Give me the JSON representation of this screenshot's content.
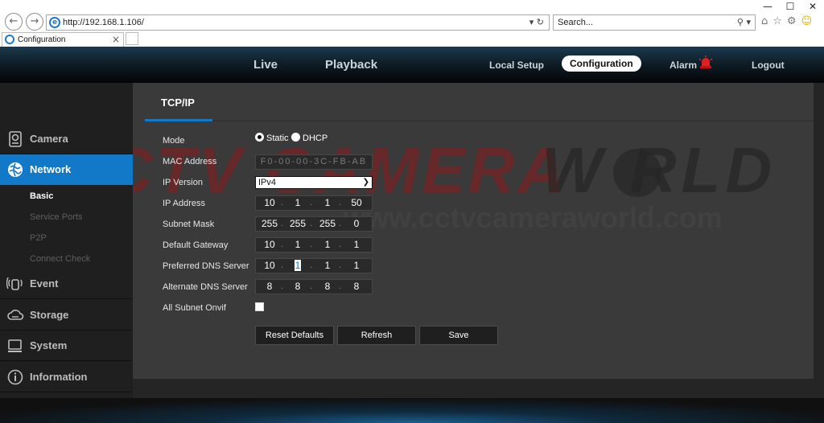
{
  "browser": {
    "url": "http://192.168.1.106/",
    "search_placeholder": "Search...",
    "tab_title": "Configuration",
    "window_controls": [
      "—",
      "☐",
      "✕"
    ]
  },
  "topnav": {
    "items": [
      "Live",
      "Playback",
      "Local Setup",
      "Configuration",
      "Alarm",
      "Logout"
    ],
    "active": "Configuration"
  },
  "sidebar": {
    "groups": [
      {
        "label": "Camera",
        "icon": "camera-icon"
      },
      {
        "label": "Network",
        "icon": "network-globe-icon"
      },
      {
        "label": "Event",
        "icon": "event-signal-icon"
      },
      {
        "label": "Storage",
        "icon": "storage-cloud-icon"
      },
      {
        "label": "System",
        "icon": "system-monitor-icon"
      },
      {
        "label": "Information",
        "icon": "info-icon"
      }
    ],
    "network_subitems": [
      "Basic",
      "Service Ports",
      "P2P",
      "Connect Check"
    ],
    "active_group": "Network",
    "active_subitem": "Basic"
  },
  "content": {
    "tab": "TCP/IP",
    "watermark": {
      "brand": "CCTV CAMERA",
      "brand_right": "W  RLD",
      "site": "www.cctvcameraworld.com"
    },
    "form": {
      "mode_label": "Mode",
      "mode_options": [
        "Static",
        "DHCP"
      ],
      "mode_selected": "Static",
      "mac_label": "MAC Address",
      "mac_value": "F0-00-00-3C-FB-AB",
      "ip_version_label": "IP Version",
      "ip_version_value": "IPv4",
      "ip_address_label": "IP Address",
      "ip_address": [
        "10",
        "1",
        "1",
        "50"
      ],
      "subnet_label": "Subnet Mask",
      "subnet": [
        "255",
        "255",
        "255",
        "0"
      ],
      "gateway_label": "Default Gateway",
      "gateway": [
        "10",
        "1",
        "1",
        "1"
      ],
      "pref_dns_label": "Preferred DNS Server",
      "pref_dns": [
        "10",
        "1",
        "1",
        "1"
      ],
      "alt_dns_label": "Alternate DNS Server",
      "alt_dns": [
        "8",
        "8",
        "8",
        "8"
      ],
      "onvif_label": "All Subnet Onvif",
      "onvif_checked": false
    },
    "buttons": {
      "reset": "Reset Defaults",
      "refresh": "Refresh",
      "save": "Save"
    }
  },
  "colors": {
    "accent": "#1279c9",
    "watermark_red": "#8b1a1a",
    "alarm_red": "#e02020"
  }
}
